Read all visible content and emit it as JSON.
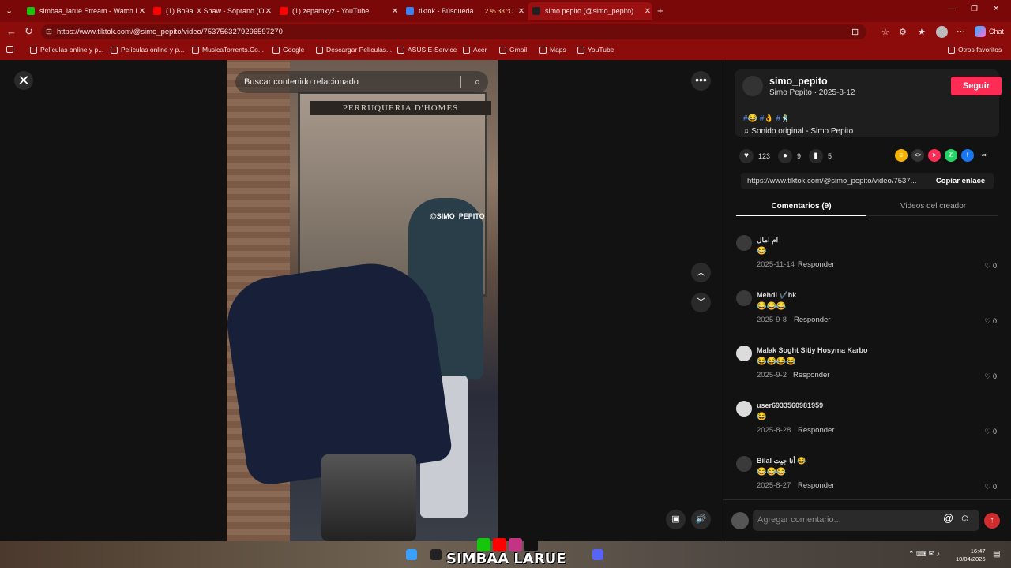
{
  "browser": {
    "tabs": [
      {
        "title": "simbaa_larue Stream - Watch Live",
        "color": "#16c60c"
      },
      {
        "title": "(1) Bo9al X Shaw - Soprano (Offici",
        "color": "#ff0000"
      },
      {
        "title": "(1) zepamxyz - YouTube",
        "color": "#ff0000"
      },
      {
        "title": "tiktok - Búsqueda",
        "color": "#3b82f6"
      },
      {
        "title": "simo pepito (@simo_pepito)",
        "color": "#222222"
      }
    ],
    "url": "https://www.tiktok.com/@simo_pepito/video/7537563279296597270",
    "bookmarks": [
      "Películas online y p...",
      "Películas online y p...",
      "MusicaTorrents.Co...",
      "Google",
      "Descargar Películas...",
      "ASUS E-Service",
      "Acer",
      "Gmail",
      "Maps",
      "YouTube"
    ],
    "other_favorites": "Otros favoritos",
    "chat_label": "Chat",
    "tab_stats": "2 %   38 °C"
  },
  "video": {
    "search_placeholder": "Buscar contenido relacionado",
    "watermark": "@SIMO_PEPITO",
    "shop_sign": "PERRUQUERIA D'HOMES"
  },
  "panel": {
    "username": "simo_pepito",
    "subline": "Simo Pepito · 2025-8-12",
    "follow_label": "Seguir",
    "tags": "#😂 #👌 #🕺",
    "sound": "Sonido original - Simo Pepito",
    "likes": "123",
    "comments_count": "9",
    "saves": "5",
    "link": "https://www.tiktok.com/@simo_pepito/video/7537...",
    "copy_label": "Copiar enlace",
    "tab_comments": "Comentarios (9)",
    "tab_videos": "Videos del creador",
    "add_comment_placeholder": "Agregar comentario...",
    "comments": [
      {
        "name": "ام امال",
        "text": "😂",
        "date": "2025-11-14",
        "reply": "Responder",
        "likes": "0"
      },
      {
        "name": "Mehdi ✔️hk",
        "text": "😂😂😂",
        "date": "2025-9-8",
        "reply": "Responder",
        "likes": "0"
      },
      {
        "name": "Malak Soght Sitiy Hosyma Karbo",
        "text": "😂😂😂😂",
        "date": "2025-9-2",
        "reply": "Responder",
        "likes": "0"
      },
      {
        "name": "user6933560981959",
        "text": "😂",
        "date": "2025-8-28",
        "reply": "Responder",
        "likes": "0"
      },
      {
        "name": "Bilal أنا جيت 😂",
        "text": "😂😂😂",
        "date": "2025-8-27",
        "reply": "Responder",
        "likes": "0"
      }
    ]
  },
  "taskbar": {
    "overlay_text": "SIMBAA LARUE",
    "time": "16:47",
    "date": "10/04/2026"
  }
}
